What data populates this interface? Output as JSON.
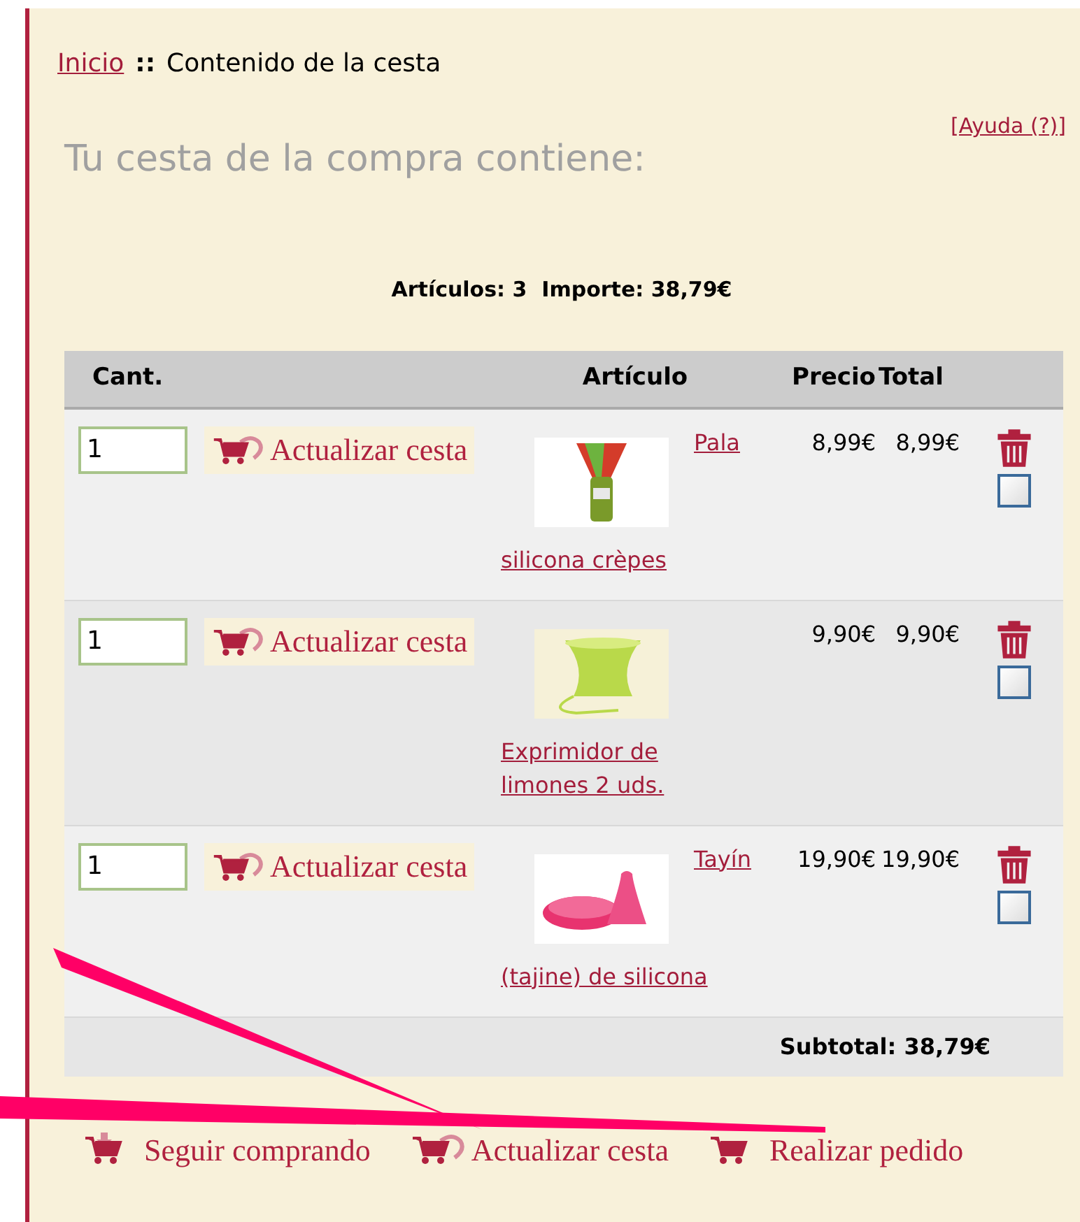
{
  "breadcrumb": {
    "home": "Inicio",
    "separator": "::",
    "current": "Contenido de la cesta"
  },
  "heading": "Tu cesta de la compra contiene:",
  "help_link": "[Ayuda (?)]",
  "summary": "Artículos: 3  Importe: 38,79€",
  "table": {
    "columns": [
      "Cant.",
      "Artículo",
      "Precio",
      "Total"
    ],
    "rows": [
      {
        "quantity": "1",
        "update_button": "Actualizar cesta",
        "name_beside": "Pala",
        "name_below": "silicona crèpes",
        "price": "8,99€",
        "total": "8,99€",
        "checked": false
      },
      {
        "quantity": "1",
        "update_button": "Actualizar cesta",
        "name_below": "Exprimidor de limones 2 uds.",
        "price": "9,90€",
        "total": "9,90€",
        "checked": false
      },
      {
        "quantity": "1",
        "update_button": "Actualizar cesta",
        "name_beside": "Tayín",
        "name_below": "(tajine) de silicona",
        "price": "19,90€",
        "total": "19,90€",
        "checked": false
      }
    ],
    "subtotal": "Subtotal: 38,79€"
  },
  "actions": [
    {
      "kind": "continue",
      "label": "Seguir comprando"
    },
    {
      "kind": "update",
      "label": "Actualizar cesta"
    },
    {
      "kind": "checkout",
      "label": "Realizar pedido"
    }
  ]
}
